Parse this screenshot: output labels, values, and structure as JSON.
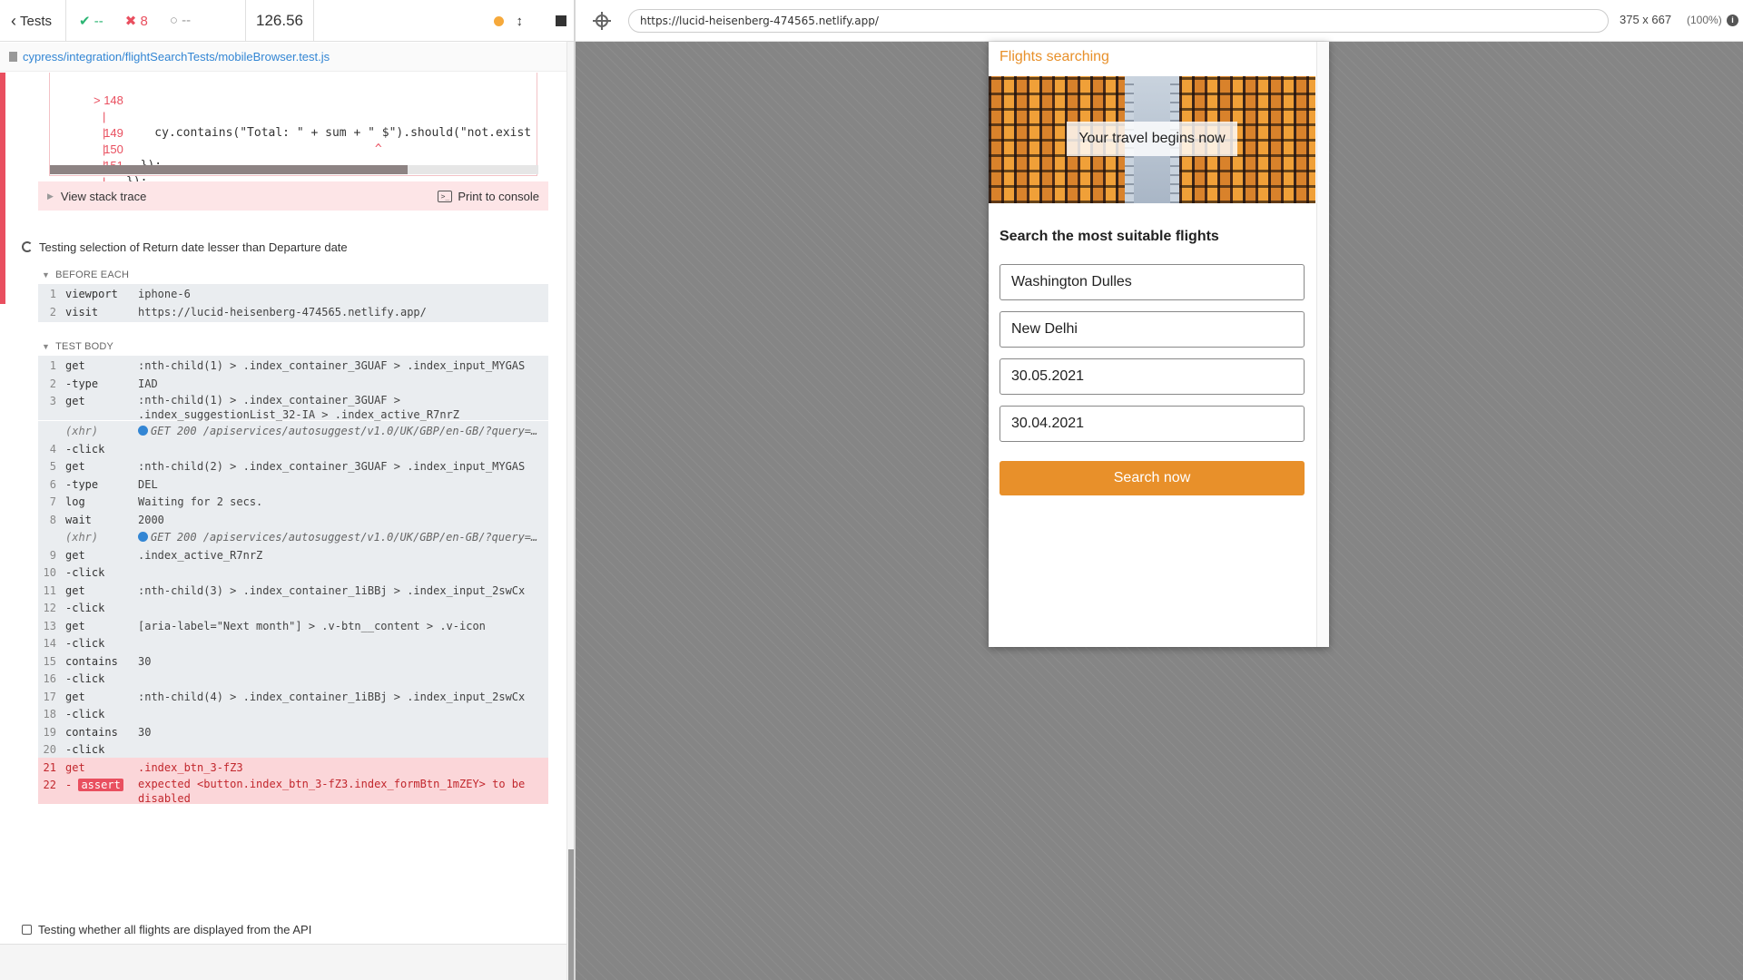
{
  "header": {
    "back_label": "Tests",
    "passed": "--",
    "failed": "8",
    "pending": "--",
    "duration": "126.56"
  },
  "spec_path": "cypress/integration/flightSearchTests/mobileBrowser.test.js",
  "code_frame": {
    "lines": [
      {
        "ln": "> 148",
        "pipe": "|",
        "text": "    cy.contains(\"Total: \" + sum + \" $\").should(\"not.exist"
      },
      {
        "ln": "",
        "pipe": "|",
        "text": "                                   ^"
      },
      {
        "ln": "149",
        "pipe": "|",
        "text": "  });"
      },
      {
        "ln": "150",
        "pipe": "|",
        "text": "});"
      },
      {
        "ln": "151",
        "pipe": "|",
        "text": ""
      }
    ],
    "stack_trace_label": "View stack trace",
    "print_label": "Print to console",
    "print_icon_glyph": ">_"
  },
  "test1": {
    "title": "Testing selection of Return date lesser than Departure date",
    "before_each_label": "BEFORE EACH",
    "before_each": [
      {
        "n": "1",
        "name": "viewport",
        "msg": "iphone-6"
      },
      {
        "n": "2",
        "name": "visit",
        "msg": "https://lucid-heisenberg-474565.netlify.app/"
      }
    ],
    "test_body_label": "TEST BODY",
    "test_body": [
      {
        "n": "1",
        "name": "get",
        "msg": ":nth-child(1) > .index_container_3GUAF > .index_input_MYGAS"
      },
      {
        "n": "2",
        "name": "-type",
        "msg": "IAD"
      },
      {
        "n": "3",
        "name": "get",
        "msg": ":nth-child(1) > .index_container_3GUAF > .index_suggestionList_32-IA > .index_active_R7nrZ"
      },
      {
        "n": "",
        "name": "(xhr)",
        "msg": "GET 200 /apiservices/autosuggest/v1.0/UK/GBP/en-GB/?query=…"
      },
      {
        "n": "4",
        "name": "-click",
        "msg": ""
      },
      {
        "n": "5",
        "name": "get",
        "msg": ":nth-child(2) > .index_container_3GUAF > .index_input_MYGAS"
      },
      {
        "n": "6",
        "name": "-type",
        "msg": "DEL"
      },
      {
        "n": "7",
        "name": "log",
        "msg": "Waiting for 2 secs."
      },
      {
        "n": "8",
        "name": "wait",
        "msg": "2000"
      },
      {
        "n": "",
        "name": "(xhr)",
        "msg": "GET 200 /apiservices/autosuggest/v1.0/UK/GBP/en-GB/?query=…"
      },
      {
        "n": "9",
        "name": "get",
        "msg": ".index_active_R7nrZ"
      },
      {
        "n": "10",
        "name": "-click",
        "msg": ""
      },
      {
        "n": "11",
        "name": "get",
        "msg": ":nth-child(3) > .index_container_1iBBj > .index_input_2swCx"
      },
      {
        "n": "12",
        "name": "-click",
        "msg": ""
      },
      {
        "n": "13",
        "name": "get",
        "msg": "[aria-label=\"Next month\"] > .v-btn__content > .v-icon"
      },
      {
        "n": "14",
        "name": "-click",
        "msg": ""
      },
      {
        "n": "15",
        "name": "contains",
        "msg": "30"
      },
      {
        "n": "16",
        "name": "-click",
        "msg": ""
      },
      {
        "n": "17",
        "name": "get",
        "msg": ":nth-child(4) > .index_container_1iBBj > .index_input_2swCx"
      },
      {
        "n": "18",
        "name": "-click",
        "msg": ""
      },
      {
        "n": "19",
        "name": "contains",
        "msg": "30"
      },
      {
        "n": "20",
        "name": "-click",
        "msg": ""
      },
      {
        "n": "21",
        "name": "get",
        "msg": ".index_btn_3-fZ3"
      },
      {
        "n": "22",
        "name": "assert",
        "msg": "expected <button.index_btn_3-fZ3.index_formBtn_1mZEY> to be disabled"
      }
    ]
  },
  "test2": {
    "title": "Testing whether all flights are displayed from the API"
  },
  "aut": {
    "url": "https://lucid-heisenberg-474565.netlify.app/",
    "viewport_size": "375 x 667",
    "viewport_pct": "(100%)",
    "info_glyph": "i"
  },
  "app": {
    "title": "Flights searching",
    "hero_caption": "Your travel begins now",
    "form_heading": "Search the most suitable flights",
    "from_value": "Washington Dulles",
    "to_value": "New Delhi",
    "depart_value": "30.05.2021",
    "return_value": "30.04.2021",
    "search_button": "Search now"
  },
  "colors": {
    "accent_orange": "#e8902a",
    "pass_green": "#2bb573",
    "fail_red": "#e94f5f",
    "link_blue": "#3386d4"
  }
}
